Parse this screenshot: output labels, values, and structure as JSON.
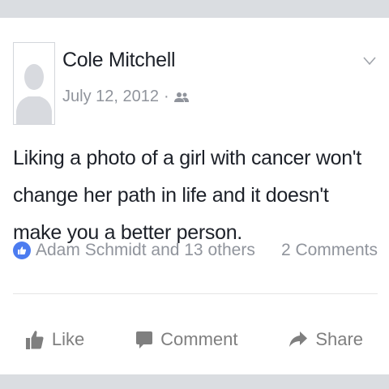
{
  "post": {
    "author": "Cole Mitchell",
    "date": "July 12, 2012",
    "separator": "·",
    "text": "Liking a photo of a girl with cancer won't change her path in life and it doesn't make you a better person.",
    "likes_text": "Adam Schmidt and 13 others",
    "comments_count": "2 Comments"
  },
  "actions": {
    "like_label": "Like",
    "comment_label": "Comment",
    "share_label": "Share"
  },
  "colors": {
    "text": "#1d2129",
    "meta": "#90949c",
    "like_badge": "#4c7cf0",
    "action": "#7f7f7f",
    "bars": "#dadde1"
  },
  "icons": {
    "avatar": "default-profile-silhouette",
    "audience": "friends-icon",
    "menu": "chevron-down-icon",
    "like_badge": "thumbs-up-icon",
    "like": "thumbs-up-icon",
    "comment": "speech-bubble-icon",
    "share": "share-arrow-icon"
  }
}
